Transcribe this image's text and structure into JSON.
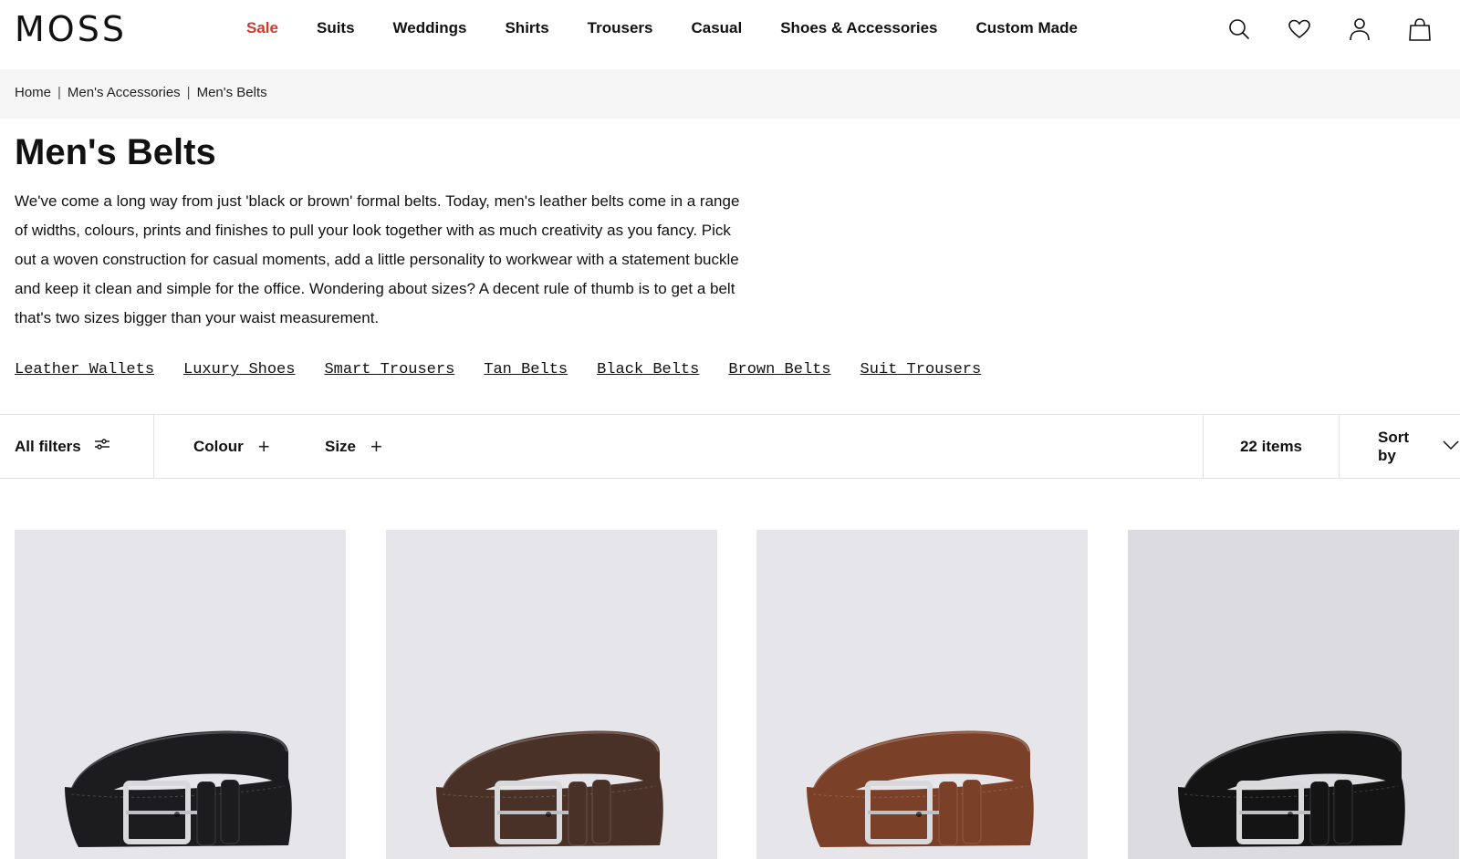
{
  "brand": {
    "logo_text": "MOSS"
  },
  "nav": {
    "items": [
      {
        "label": "Sale",
        "accent": "#d0392b"
      },
      {
        "label": "Suits"
      },
      {
        "label": "Weddings"
      },
      {
        "label": "Shirts"
      },
      {
        "label": "Trousers"
      },
      {
        "label": "Casual"
      },
      {
        "label": "Shoes & Accessories"
      },
      {
        "label": "Custom Made"
      }
    ]
  },
  "header_icons": [
    "search-icon",
    "heart-icon",
    "account-icon",
    "bag-icon"
  ],
  "breadcrumb": [
    "Home",
    "Men's Accessories",
    "Men's Belts"
  ],
  "page": {
    "title": "Men's Belts",
    "description": "We've come a long way from just 'black or brown' formal belts. Today, men's leather belts come in a range of widths, colours, prints and finishes to pull your look together with as much creativity as you fancy. Pick out a woven construction for casual moments, add a little personality to workwear with a statement buckle and keep it clean and simple for the office. Wondering about sizes? A decent rule of thumb is to get a belt that's two sizes bigger than your waist measurement."
  },
  "related_links": [
    "Leather Wallets",
    "Luxury Shoes",
    "Smart Trousers",
    "Tan Belts",
    "Black Belts",
    "Brown Belts",
    "Suit Trousers"
  ],
  "filters": {
    "all_filters_label": "All filters",
    "colour_label": "Colour",
    "size_label": "Size",
    "items_count": "22 items",
    "sort_label": "Sort by"
  },
  "products": [
    {
      "name": "black-belt",
      "leather_color": "#1c1c1e"
    },
    {
      "name": "dark-brown-belt",
      "leather_color": "#4a3128"
    },
    {
      "name": "tan-belt",
      "leather_color": "#7a4028"
    },
    {
      "name": "black-belt-2",
      "leather_color": "#141414"
    }
  ]
}
